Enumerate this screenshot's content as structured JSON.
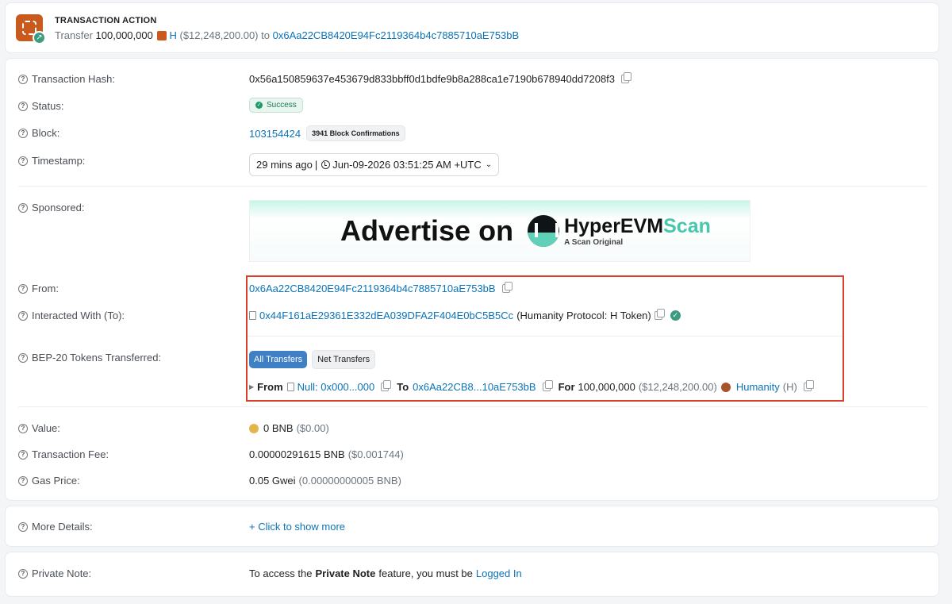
{
  "action": {
    "title": "TRANSACTION ACTION",
    "verb": "Transfer",
    "amount": "100,000,000",
    "token_symbol": "H",
    "usd_value": "($12,248,200.00)",
    "to_word": "to",
    "to_address": "0x6Aa22CB8420E94Fc2119364b4c7885710aE753bB"
  },
  "details": {
    "tx_hash": {
      "label": "Transaction Hash:",
      "value": "0x56a150859637e453679d833bbff0d1bdfe9b8a288ca1e7190b678940dd7208f3"
    },
    "status": {
      "label": "Status:",
      "value": "Success"
    },
    "block": {
      "label": "Block:",
      "value": "103154424",
      "confirmations": "3941 Block Confirmations"
    },
    "timestamp": {
      "label": "Timestamp:",
      "relative": "29 mins ago",
      "absolute": "Jun-09-2026 03:51:25 AM +UTC"
    },
    "sponsored": {
      "label": "Sponsored:",
      "ad_text": "Advertise on",
      "brand_main": "HyperEVM",
      "brand_accent": "Scan",
      "brand_sub": "A Scan Original"
    },
    "from": {
      "label": "From:",
      "value": "0x6Aa22CB8420E94Fc2119364b4c7885710aE753bB"
    },
    "to": {
      "label": "Interacted With (To):",
      "value": "0x44F161aE29361E332dEA039DFA2F404E0bC5B5Cc",
      "name": "(Humanity Protocol: H Token)"
    },
    "tokens": {
      "label": "BEP-20 Tokens Transferred:",
      "tabs": [
        "All Transfers",
        "Net Transfers"
      ],
      "transfer": {
        "from_word": "From",
        "from_value": "Null: 0x000...000",
        "to_word": "To",
        "to_value": "0x6Aa22CB8...10aE753bB",
        "for_word": "For",
        "amount": "100,000,000",
        "usd": "($12,248,200.00)",
        "token_name": "Humanity",
        "token_symbol": "(H)"
      }
    },
    "value": {
      "label": "Value:",
      "amount": "0 BNB",
      "usd": "($0.00)"
    },
    "fee": {
      "label": "Transaction Fee:",
      "amount": "0.00000291615 BNB",
      "usd": "($0.001744)"
    },
    "gas": {
      "label": "Gas Price:",
      "amount": "0.05 Gwei",
      "sub": "(0.00000000005 BNB)"
    }
  },
  "more": {
    "label": "More Details:",
    "action": "+ Click to show more"
  },
  "note": {
    "label": "Private Note:",
    "pre": "To access the",
    "bold": "Private Note",
    "mid": "feature, you must be",
    "link": "Logged In"
  },
  "colors": {
    "link": "#0b73b7",
    "highlight": "#d9412b",
    "success": "#1c9a68",
    "tab_active": "#3f7fc4"
  }
}
